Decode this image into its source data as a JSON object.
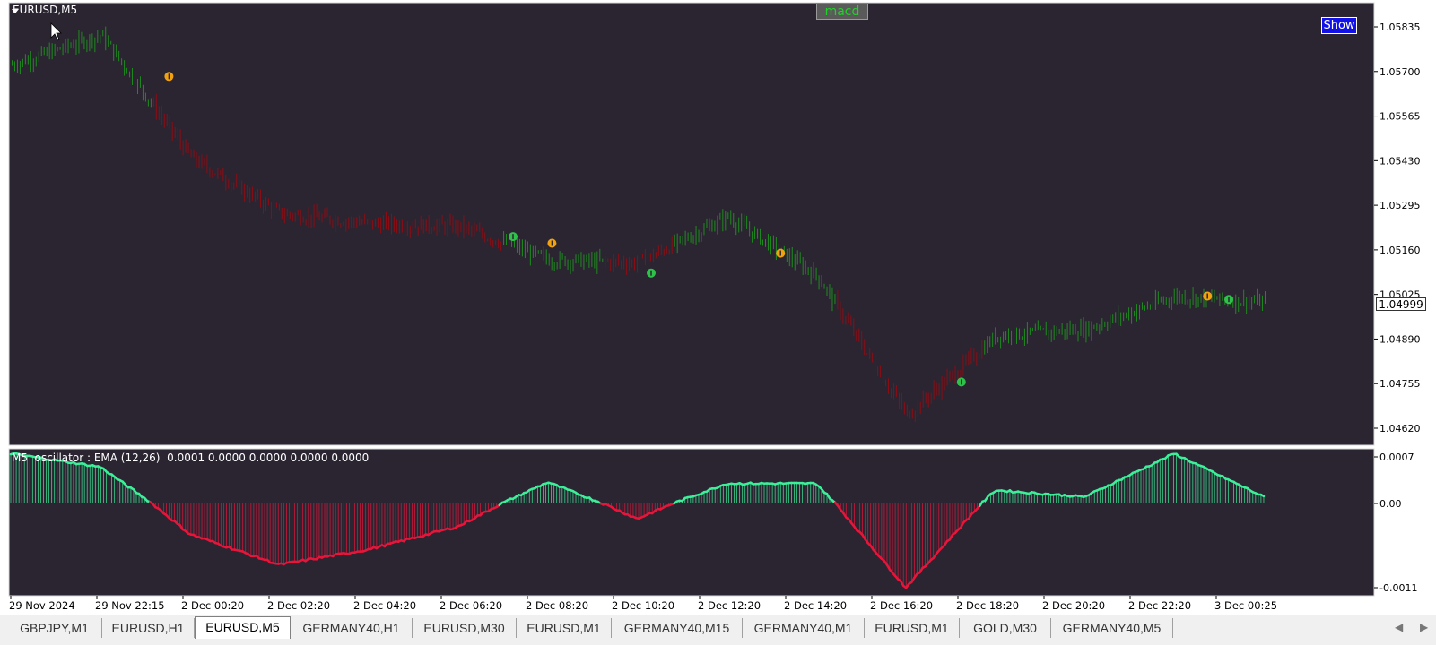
{
  "chart": {
    "symbol": "EURUSD,M5",
    "macd_button": "macd",
    "show_button": "Show",
    "current_price": "1.04999",
    "price_ticks": [
      "1.05835",
      "1.05700",
      "1.05565",
      "1.05430",
      "1.05295",
      "1.05160",
      "1.05025",
      "1.04890",
      "1.04755",
      "1.04620"
    ],
    "indicator_label": "M5  oscillator : EMA (12,26)  0.0001 0.0000 0.0000 0.0000 0.0000",
    "indicator_ticks": [
      "0.0007",
      "0.00",
      "-0.0011"
    ],
    "time_labels": [
      "29 Nov 2024",
      "29 Nov 22:15",
      "2 Dec 00:20",
      "2 Dec 02:20",
      "2 Dec 04:20",
      "2 Dec 06:20",
      "2 Dec 08:20",
      "2 Dec 10:20",
      "2 Dec 12:20",
      "2 Dec 14:20",
      "2 Dec 16:20",
      "2 Dec 18:20",
      "2 Dec 20:20",
      "2 Dec 22:20",
      "3 Dec 00:25"
    ],
    "colors": {
      "background": "#2b2532",
      "bull": "#1e8a1e",
      "bear": "#8b0d14",
      "osc_up": "#3cf09a",
      "osc_down": "#e8153a",
      "signal_buy": "#2fc24a",
      "signal_sell": "#f2a20e"
    }
  },
  "chart_data": {
    "type": "line",
    "title": "EURUSD,M5",
    "xlabel": "",
    "ylabel": "",
    "ylim": [
      1.0458,
      1.0593
    ],
    "x": [
      "29 Nov 2024",
      "29 Nov 22:15",
      "2 Dec 00:20",
      "2 Dec 02:20",
      "2 Dec 04:20",
      "2 Dec 06:20",
      "2 Dec 08:20",
      "2 Dec 10:20",
      "2 Dec 12:20",
      "2 Dec 14:20",
      "2 Dec 16:20",
      "2 Dec 18:20",
      "2 Dec 20:20",
      "2 Dec 22:20",
      "3 Dec 00:25"
    ],
    "series": [
      {
        "name": "EURUSD,M5",
        "values": [
          1.0572,
          1.0581,
          1.0544,
          1.0527,
          1.0524,
          1.0523,
          1.0513,
          1.0512,
          1.0526,
          1.0508,
          1.0466,
          1.049,
          1.0492,
          1.0502,
          1.05
        ]
      },
      {
        "name": "M5  oscillator : EMA (12,26)",
        "values": [
          0.00075,
          0.00055,
          -0.0004,
          -0.0008,
          -0.0006,
          -0.0003,
          0.00032,
          -0.0002,
          0.0003,
          0.0003,
          -0.0011,
          0.0002,
          0.0001,
          0.00075,
          0.0001
        ]
      }
    ],
    "indicator_ylim": [
      -0.00115,
      0.0009
    ]
  },
  "tabs": [
    {
      "label": "GBPJPY,M1",
      "active": false
    },
    {
      "label": "EURUSD,H1",
      "active": false
    },
    {
      "label": "EURUSD,M5",
      "active": true
    },
    {
      "label": "GERMANY40,H1",
      "active": false
    },
    {
      "label": "EURUSD,M30",
      "active": false
    },
    {
      "label": "EURUSD,M1",
      "active": false
    },
    {
      "label": "GERMANY40,M15",
      "active": false
    },
    {
      "label": "GERMANY40,M1",
      "active": false
    },
    {
      "label": "EURUSD,M1",
      "active": false
    },
    {
      "label": "GOLD,M30",
      "active": false
    },
    {
      "label": "GERMANY40,M5",
      "active": false
    }
  ]
}
